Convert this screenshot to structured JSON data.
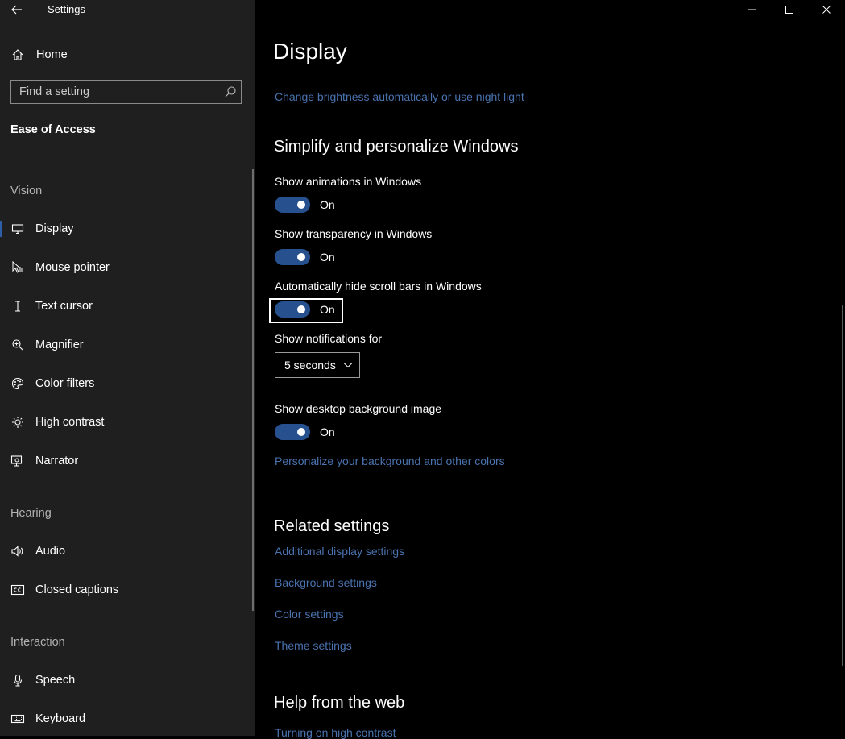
{
  "window": {
    "title": "Settings",
    "controls": [
      "minimize",
      "maximize",
      "close"
    ]
  },
  "sidebar": {
    "home_label": "Home",
    "search": {
      "placeholder": "Find a setting",
      "value": ""
    },
    "section_title": "Ease of Access",
    "groups": {
      "vision": "Vision",
      "hearing": "Hearing",
      "interaction": "Interaction"
    },
    "items": {
      "display": {
        "label": "Display",
        "icon": "monitor-icon",
        "selected": true
      },
      "mouse_pointer": {
        "label": "Mouse pointer",
        "icon": "mouse-pointer-icon"
      },
      "text_cursor": {
        "label": "Text cursor",
        "icon": "text-cursor-icon"
      },
      "magnifier": {
        "label": "Magnifier",
        "icon": "magnifier-icon"
      },
      "color_filters": {
        "label": "Color filters",
        "icon": "palette-icon"
      },
      "high_contrast": {
        "label": "High contrast",
        "icon": "sun-icon"
      },
      "narrator": {
        "label": "Narrator",
        "icon": "narrator-icon"
      },
      "audio": {
        "label": "Audio",
        "icon": "speaker-icon"
      },
      "closed_captions": {
        "label": "Closed captions",
        "icon": "cc-icon"
      },
      "speech": {
        "label": "Speech",
        "icon": "microphone-icon"
      },
      "keyboard": {
        "label": "Keyboard",
        "icon": "keyboard-icon"
      }
    }
  },
  "main": {
    "page_title": "Display",
    "brightness_link": "Change brightness automatically or use night light",
    "simplify": {
      "heading": "Simplify and personalize Windows",
      "animations": {
        "label": "Show animations in Windows",
        "state": "On"
      },
      "transparency": {
        "label": "Show transparency in Windows",
        "state": "On"
      },
      "scrollbars": {
        "label": "Automatically hide scroll bars in Windows",
        "state": "On"
      },
      "notifications": {
        "label": "Show notifications for",
        "value": "5 seconds"
      },
      "desktop_bg": {
        "label": "Show desktop background image",
        "state": "On"
      },
      "personalize_link": "Personalize your background and other colors"
    },
    "related": {
      "heading": "Related settings",
      "links": {
        "additional_display": "Additional display settings",
        "background": "Background settings",
        "color": "Color settings",
        "theme": "Theme settings"
      }
    },
    "help": {
      "heading": "Help from the web",
      "link": "Turning on high contrast"
    }
  },
  "colors": {
    "accent": "#27508f",
    "link": "#4a73b0",
    "sidebar_bg": "#1f1f1f",
    "main_bg": "#000000"
  }
}
